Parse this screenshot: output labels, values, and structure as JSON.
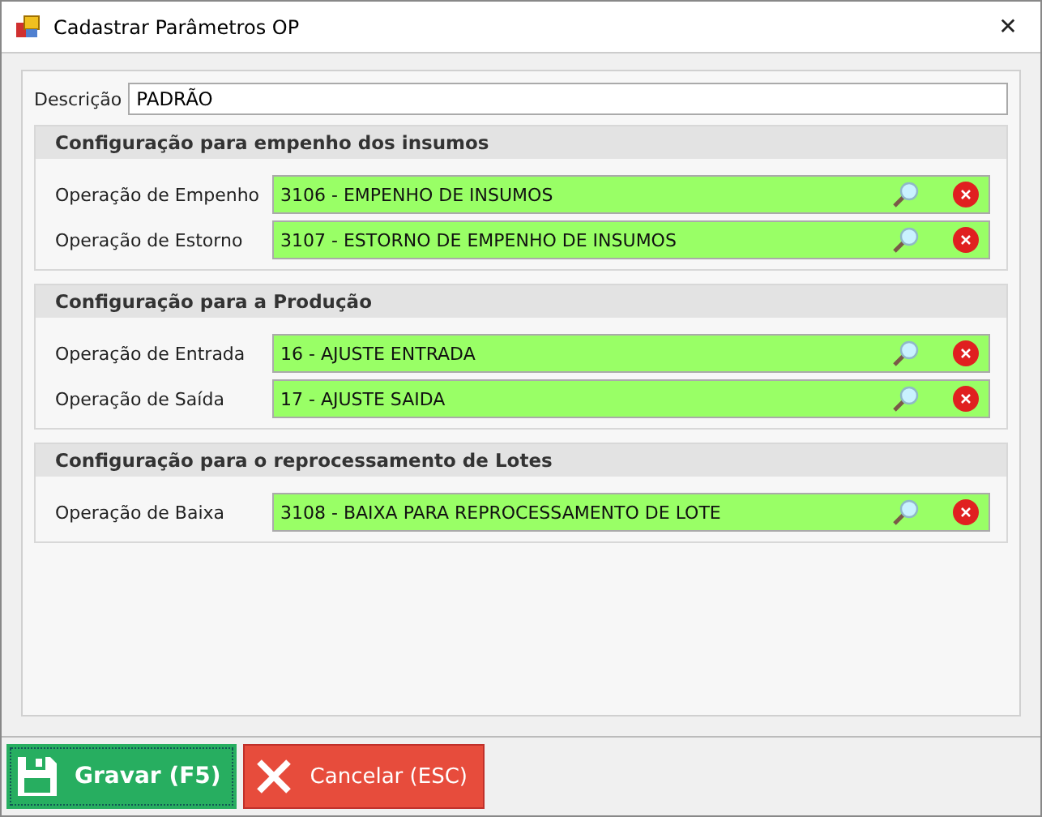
{
  "window": {
    "title": "Cadastrar Parâmetros OP",
    "close": "✕"
  },
  "description": {
    "label": "Descrição",
    "value": "PADRÃO"
  },
  "groups": [
    {
      "title": "Configuração para empenho dos insumos",
      "rows": [
        {
          "label": "Operação de Empenho",
          "value": "3106 - EMPENHO DE INSUMOS"
        },
        {
          "label": "Operação de Estorno",
          "value": "3107 - ESTORNO DE EMPENHO DE INSUMOS"
        }
      ]
    },
    {
      "title": "Configuração para a Produção",
      "rows": [
        {
          "label": "Operação de Entrada",
          "value": "16 - AJUSTE ENTRADA"
        },
        {
          "label": "Operação de Saída",
          "value": "17 - AJUSTE SAIDA"
        }
      ]
    },
    {
      "title": "Configuração para o reprocessamento de Lotes",
      "rows": [
        {
          "label": "Operação de Baixa",
          "value": "3108 - BAIXA PARA REPROCESSAMENTO DE LOTE"
        }
      ]
    }
  ],
  "buttons": [
    {
      "kind": "save",
      "label": "Gravar (F5)"
    },
    {
      "kind": "cancel",
      "label": "Cancelar (ESC)"
    }
  ]
}
